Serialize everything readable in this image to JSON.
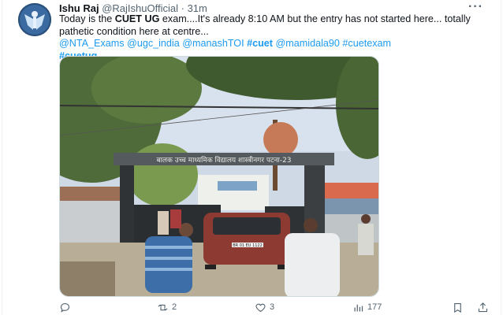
{
  "tweet": {
    "author": {
      "display_name": "Ishu Raj",
      "handle": "@RajIshuOfficial",
      "separator": "·",
      "time": "31m",
      "avatar": "avatar-icon"
    },
    "more_label": "···",
    "text": {
      "part1": "Today is the ",
      "bold": "CUET UG",
      "part2": " exam....It's already 8:10 AM but the entry has not started here... totally pathetic condition here at centre...",
      "mentions": [
        "@NTA_Exams",
        "@ugc_india",
        "@manashTOI"
      ],
      "hashtag1": "#cuet",
      "mention4": "@mamidala90",
      "hashtag2": "#cuetexam",
      "hashtag3": "#cuetug"
    },
    "photo": {
      "gate_sign": "बालक उच्च माध्यमिक विद्यालय शास्त्रीनगर पटना-23",
      "car_plate": "BR 01 EU 1122"
    },
    "actions": {
      "reply": {
        "icon": "reply-icon",
        "count": ""
      },
      "retweet": {
        "icon": "retweet-icon",
        "count": "2"
      },
      "like": {
        "icon": "heart-icon",
        "count": "3"
      },
      "views": {
        "icon": "views-icon",
        "count": "177"
      },
      "bookmark": {
        "icon": "bookmark-icon"
      },
      "share": {
        "icon": "share-icon"
      }
    },
    "colors": {
      "link": "#1d9bf0",
      "text": "#0f1419",
      "muted": "#536471"
    }
  }
}
